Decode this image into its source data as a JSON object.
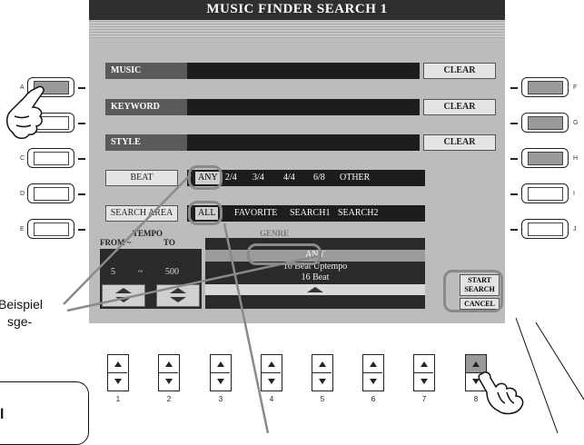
{
  "screen": {
    "title": "MUSIC FINDER SEARCH 1",
    "fields": [
      {
        "label": "MUSIC",
        "clear_label": "CLEAR"
      },
      {
        "label": "KEYWORD",
        "clear_label": "CLEAR"
      },
      {
        "label": "STYLE",
        "clear_label": "CLEAR"
      }
    ],
    "beat": {
      "label": "BEAT",
      "options": [
        "ANY",
        "2/4",
        "3/4",
        "4/4",
        "6/8",
        "OTHER"
      ],
      "selected": "ANY"
    },
    "search_area": {
      "label": "SEARCH AREA",
      "options": [
        "ALL",
        "FAVORITE",
        "SEARCH1",
        "SEARCH2"
      ],
      "selected": "ALL"
    },
    "tempo": {
      "title": "TEMPO",
      "from_label": "FROM ~",
      "to_label": "TO",
      "from_value": "5",
      "sep": "~",
      "to_value": "500"
    },
    "genre": {
      "title": "GENRE",
      "items": [
        "ANY",
        "16 Beat Uptempo",
        "16 Beat"
      ],
      "selected": "ANY"
    },
    "start_search_line1": "START",
    "start_search_line2": "SEARCH",
    "cancel_label": "CANCEL"
  },
  "left_buttons": [
    "A",
    "B",
    "C",
    "D",
    "E"
  ],
  "right_buttons": [
    "F",
    "G",
    "H",
    "I",
    "J"
  ],
  "number_buttons": [
    "1",
    "2",
    "3",
    "4",
    "5",
    "6",
    "7",
    "8"
  ],
  "caption": {
    "line1": "Beispiel",
    "line2": "sge-",
    "box_text": "l"
  },
  "colors": {
    "screen_bg": "#bcbcbc",
    "title_bar": "#2f2f2f",
    "value_bar": "#1d1d1d",
    "ring": "#8a8a8a"
  }
}
